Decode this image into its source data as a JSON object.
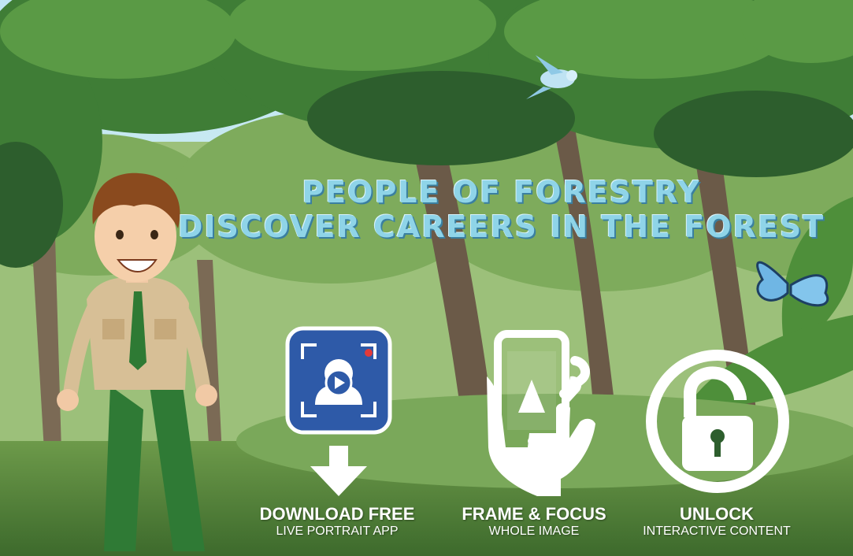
{
  "header": {
    "line1": "PEOPLE OF FORESTRY",
    "line2": "DISCOVER CAREERS IN THE FOREST"
  },
  "steps": [
    {
      "label": "DOWNLOAD FREE",
      "sub": "LIVE PORTRAIT APP",
      "icon": "app-icon"
    },
    {
      "label": "FRAME & FOCUS",
      "sub": "WHOLE IMAGE",
      "icon": "phone-hand-icon"
    },
    {
      "label": "UNLOCK",
      "sub": "INTERACTIVE CONTENT",
      "icon": "padlock-icon"
    }
  ],
  "colors": {
    "sky": "#a9d8ef",
    "foliage": "#4f8f3e",
    "title": "#8fd4e8",
    "app_icon_bg": "#2e5aa8"
  }
}
